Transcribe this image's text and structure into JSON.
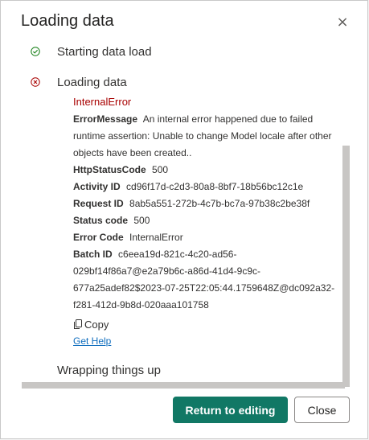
{
  "dialog": {
    "title": "Loading data",
    "close_glyph": "×"
  },
  "steps": [
    {
      "label": "Starting data load",
      "status": "success",
      "icon": "check-circle-icon",
      "color": "#107c10"
    },
    {
      "label": "Loading data",
      "status": "error",
      "icon": "error-circle-icon",
      "color": "#a80000"
    },
    {
      "label": "Wrapping things up",
      "status": "pending"
    }
  ],
  "error": {
    "title": "InternalError",
    "message_label": "ErrorMessage",
    "message_lines": [
      "An internal error happened due to failed",
      "runtime assertion: Unable to change Model locale after other",
      "objects have been created.."
    ],
    "http_label": "HttpStatusCode",
    "http_value": "500",
    "activity_label": "Activity ID",
    "activity_value": "cd96f17d-c2d3-80a8-8bf7-18b56bc12c1e",
    "request_label": "Request ID",
    "request_value": "8ab5a551-272b-4c7b-bc7a-97b38c2be38f",
    "status_label": "Status code",
    "status_value": "500",
    "code_label": "Error Code",
    "code_value": "InternalError",
    "batch_label": "Batch ID",
    "batch_lines": [
      "c6eea19d-821c-4c20-ad56-",
      "029bf14f86a7@e2a79b6c-a86d-41d4-9c9c-",
      "677a25adef82$2023-07-25T22:05:44.1759648Z@dc092a32-",
      "f281-412d-9b8d-020aaa101758"
    ],
    "copy_label": "Copy",
    "help_label": "Get Help"
  },
  "buttons": {
    "primary": "Return to editing",
    "secondary": "Close"
  },
  "colors": {
    "accent": "#117865",
    "error": "#a80000",
    "success": "#107c10",
    "link": "#106ebe"
  }
}
